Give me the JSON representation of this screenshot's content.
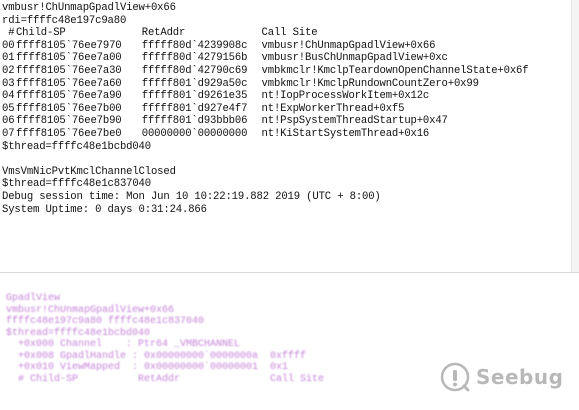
{
  "debugger": {
    "frame_header": "vmbusr!ChUnmapGpadlView+0x66",
    "rdi_line": "rdi=ffffc48e197c9a80",
    "stack_columns": {
      "num": " #",
      "child_sp": "Child-SP",
      "ret_addr": "RetAddr",
      "call_site": "Call Site"
    },
    "stack_frames": [
      {
        "num": "00",
        "child_sp": "ffff8105`76ee7970",
        "ret_addr": "fffff80d`4239908c",
        "call_site": "vmbusr!ChUnmapGpadlView+0x66"
      },
      {
        "num": "01",
        "child_sp": "ffff8105`76ee7a00",
        "ret_addr": "fffff80d`4279156b",
        "call_site": "vmbusr!BusChUnmapGpadlView+0xc"
      },
      {
        "num": "02",
        "child_sp": "ffff8105`76ee7a30",
        "ret_addr": "fffff80d`42790c69",
        "call_site": "vmbkmclr!KmclpTeardownOpenChannelState+0x6f"
      },
      {
        "num": "03",
        "child_sp": "ffff8105`76ee7a60",
        "ret_addr": "fffff801`d929a50c",
        "call_site": "vmbkmclr!KmclpRundownCountZero+0x99"
      },
      {
        "num": "04",
        "child_sp": "ffff8105`76ee7a90",
        "ret_addr": "fffff801`d9261e35",
        "call_site": "nt!IopProcessWorkItem+0x12c"
      },
      {
        "num": "05",
        "child_sp": "ffff8105`76ee7b00",
        "ret_addr": "fffff801`d927e4f7",
        "call_site": "nt!ExpWorkerThread+0xf5"
      },
      {
        "num": "06",
        "child_sp": "ffff8105`76ee7b90",
        "ret_addr": "fffff801`d93bbb06",
        "call_site": "nt!PspSystemThreadStartup+0x47"
      },
      {
        "num": "07",
        "child_sp": "ffff8105`76ee7be0",
        "ret_addr": "00000000`00000000",
        "call_site": "nt!KiStartSystemThread+0x16"
      }
    ],
    "thread_line_1": "$thread=ffffc48e1bcbd040",
    "channel_closed": "VmsVmNicPvtKmclChannelClosed",
    "thread_line_2": "$thread=ffffc48e1c837040",
    "session_time": "Debug session time: Mon Jun 10 10:22:19.882 2019 (UTC + 8:00)",
    "uptime": "System Uptime: 0 days 0:31:24.866"
  },
  "lower_pane": {
    "blurred_lines": [
      "GpadlView",
      "vmbusr!ChUnmapGpadlView+0x66",
      "ffffc48e197c9a80 ffffc48e1c837040",
      "$thread=ffffc48e1bcbd040",
      "  +0x000 Channel    : Ptr64 _VMBCHANNEL",
      "  +0x008 GpadlHandle : 0x00000000`0000000a  0xffff",
      "  +0x010 ViewMapped  : 0x00000000`00000001  0x1",
      "  # Child-SP          RetAddr               Call Site"
    ]
  },
  "watermark": {
    "text": "Seebug",
    "icon": "seebug-logo-icon",
    "color": "#8a8a8a"
  },
  "colors": {
    "text": "#111111",
    "lower_text": "#b25acb",
    "background": "#ffffff"
  }
}
